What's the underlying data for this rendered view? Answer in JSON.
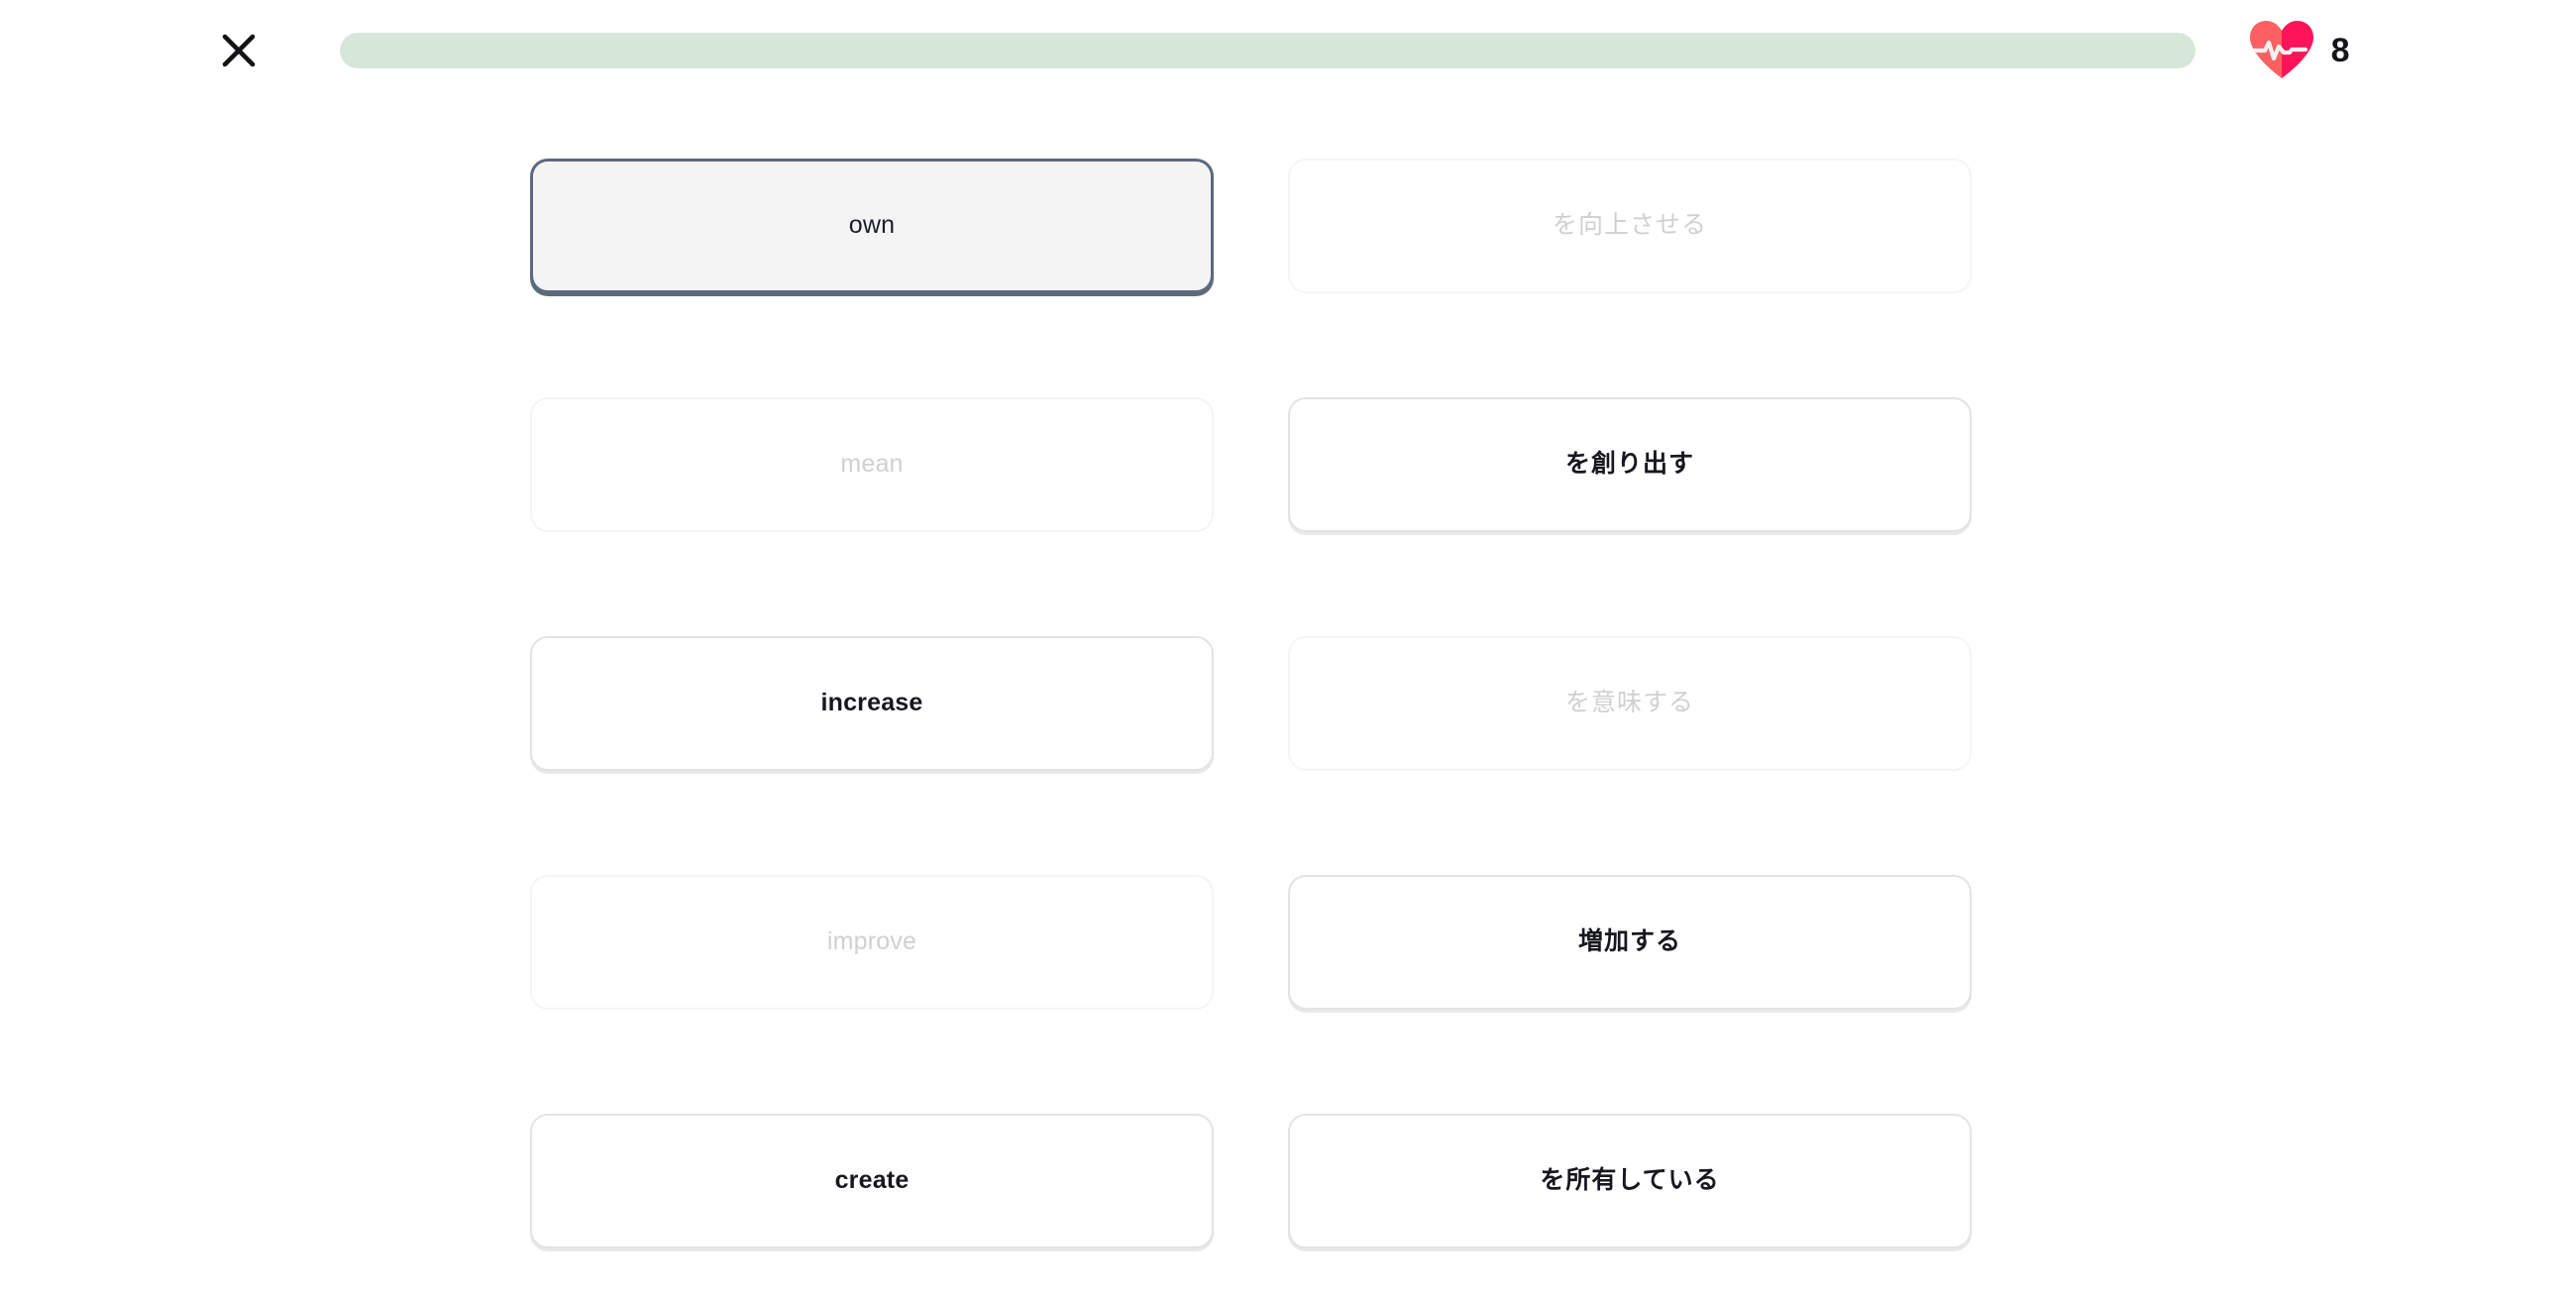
{
  "header": {
    "close_icon": "close-icon",
    "close_label": "Close",
    "progress": {
      "label": "Lesson progress",
      "percent": 100,
      "fill_color": "#d6e7da",
      "track_color": "#f0f0f0"
    },
    "lives": {
      "icon": "beating-heart-icon",
      "count": "8",
      "heart_left_color": "#fc6060",
      "heart_right_color": "#ff1359",
      "pulse_color": "#f2f2f0"
    }
  },
  "exercise": {
    "type": "match-pairs",
    "rows": [
      {
        "left": {
          "text": "own",
          "lang": "en",
          "state": "selected"
        },
        "right": {
          "text": "を向上させる",
          "lang": "ja",
          "state": "matched"
        }
      },
      {
        "left": {
          "text": "mean",
          "lang": "en",
          "state": "matched"
        },
        "right": {
          "text": "を創り出す",
          "lang": "ja",
          "state": "default"
        }
      },
      {
        "left": {
          "text": "increase",
          "lang": "en",
          "state": "default"
        },
        "right": {
          "text": "を意味する",
          "lang": "ja",
          "state": "matched"
        }
      },
      {
        "left": {
          "text": "improve",
          "lang": "en",
          "state": "matched"
        },
        "right": {
          "text": "増加する",
          "lang": "ja",
          "state": "default"
        }
      },
      {
        "left": {
          "text": "create",
          "lang": "en",
          "state": "default"
        },
        "right": {
          "text": "を所有している",
          "lang": "ja",
          "state": "default"
        }
      }
    ]
  },
  "colors": {
    "selected_border": "#5d6a7c",
    "selected_fill": "#f4f4f5",
    "card_border": "#e2e3e5",
    "matched_text": "#cfd0d2",
    "text": "#16181d",
    "background": "#ffffff"
  }
}
